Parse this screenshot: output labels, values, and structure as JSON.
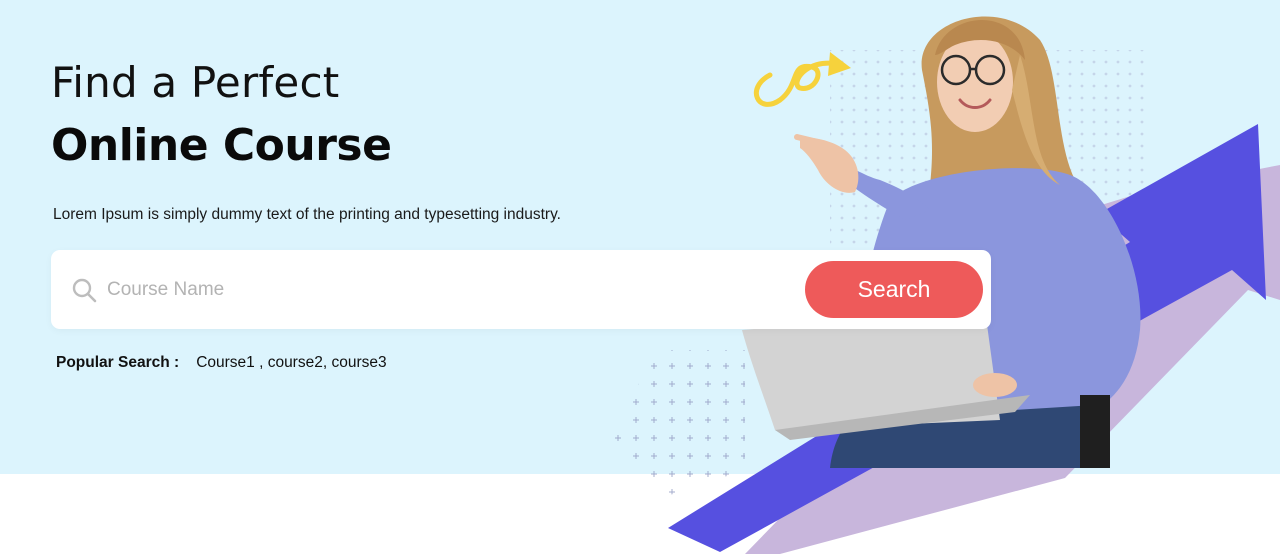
{
  "hero": {
    "title_line1": "Find a Perfect",
    "title_line2": "Online Course",
    "subtitle": "Lorem Ipsum is simply dummy text of the printing and typesetting industry."
  },
  "search": {
    "placeholder": "Course Name",
    "value": "",
    "button_label": "Search",
    "icon": "search-icon"
  },
  "popular": {
    "label": "Popular Search :",
    "items": "Course1 , course2, course3"
  },
  "colors": {
    "hero_background": "#dcf4fd",
    "search_button": "#ee5a5a",
    "arrow": "#5650e0",
    "arrow_shadow": "#c8b6dc",
    "squiggle": "#f6d23c",
    "sweater": "#8b96dd"
  }
}
